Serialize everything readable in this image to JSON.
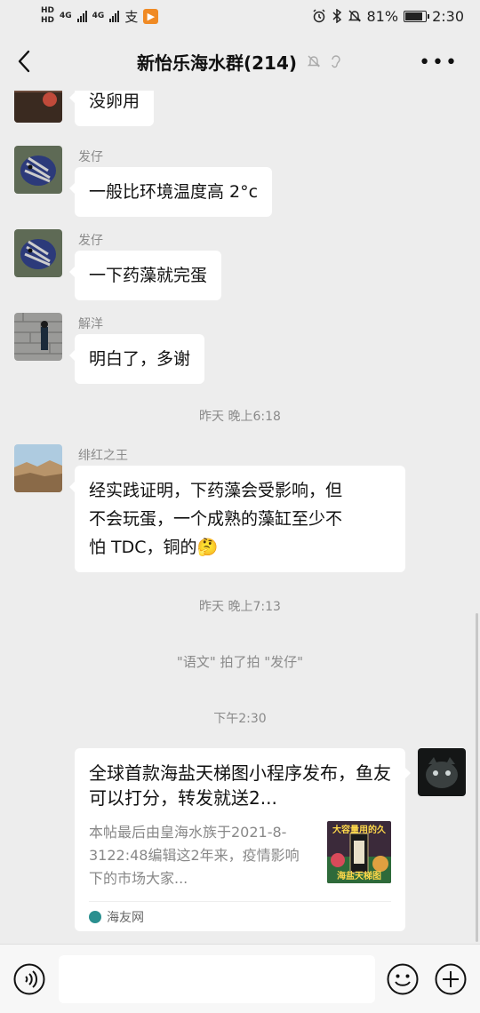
{
  "status": {
    "left_badges": [
      "HD",
      "HD"
    ],
    "net1": "4G",
    "net2": "4G",
    "alipay": "支",
    "battery": "81%",
    "time": "2:30"
  },
  "header": {
    "title": "新怡乐海水群(214)"
  },
  "messages": [
    {
      "sender": "",
      "text": "没卵用"
    },
    {
      "sender": "发仔",
      "text": "一般比环境温度高 2°c"
    },
    {
      "sender": "发仔",
      "text": "一下药藻就完蛋"
    },
    {
      "sender": "解洋",
      "text": "明白了，多谢"
    },
    {
      "sender": "绯红之王",
      "line1": "经实践证明，下药藻会受影响，但",
      "line2": "不会玩蛋，一个成熟的藻缸至少不",
      "line3": "怕 TDC，铜的🤔"
    }
  ],
  "times": [
    "昨天 晚上6:18",
    "昨天 晚上7:13",
    "下午2:30"
  ],
  "system_note": "\"语文\" 拍了拍 \"发仔\"",
  "card": {
    "title": "全球首款海盐天梯图小程序发布，鱼友可以打分，转发就送2...",
    "desc": "本帖最后由皇海水族于2021-8-3122:48编辑这2年来，疫情影响下的市场大家...",
    "source": "海友网",
    "thumb_text_top": "大容量用的久",
    "thumb_text_bottom": "海盐天梯图"
  },
  "colors": {
    "background": "#ededed",
    "bubble": "#ffffff",
    "meta_text": "#8a8a8a"
  }
}
